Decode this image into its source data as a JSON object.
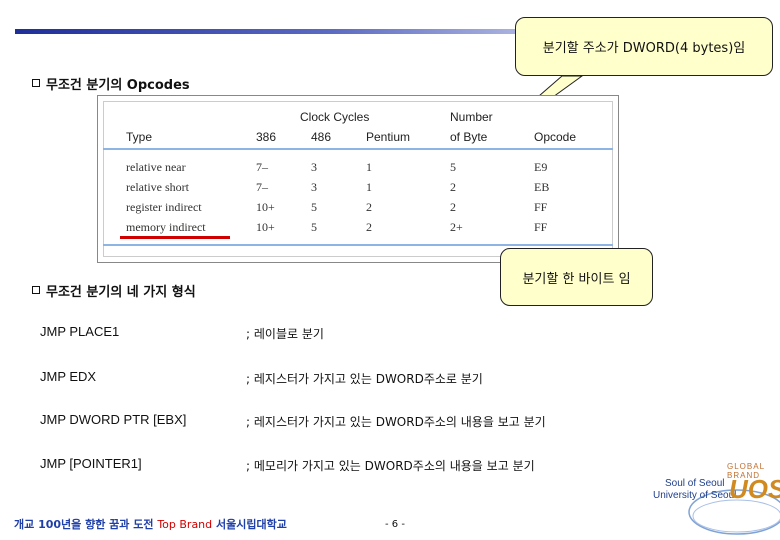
{
  "callouts": {
    "top": "분기할 주소가 DWORD(4 bytes)임",
    "bottom": "분기할 한 바이트 임"
  },
  "section1": {
    "title": "무조건 분기의 Opcodes"
  },
  "section2": {
    "title": "무조건 분기의 네 가지 형식"
  },
  "table": {
    "header_clock": "Clock Cycles",
    "header_number": "Number",
    "header_type": "Type",
    "header_386": "386",
    "header_486": "486",
    "header_pentium": "Pentium",
    "header_bytes": "of Byte",
    "header_opcode": "Opcode",
    "rows": [
      {
        "type": "relative near",
        "c386": "7–",
        "c486": "3",
        "pent": "1",
        "bytes": "5",
        "opcode": "E9"
      },
      {
        "type": "relative short",
        "c386": "7–",
        "c486": "3",
        "pent": "1",
        "bytes": "2",
        "opcode": "EB"
      },
      {
        "type": "register indirect",
        "c386": "10+",
        "c486": "5",
        "pent": "2",
        "bytes": "2",
        "opcode": "FF"
      },
      {
        "type": "memory indirect",
        "c386": "10+",
        "c486": "5",
        "pent": "2",
        "bytes": "2+",
        "opcode": "FF"
      }
    ]
  },
  "instructions": [
    {
      "code": "JMP PLACE1",
      "comment": "; 레이블로 분기"
    },
    {
      "code": "JMP EDX",
      "comment": "; 레지스터가  가지고 있는 DWORD주소로 분기"
    },
    {
      "code": "JMP DWORD PTR [EBX]",
      "comment": "; 레지스터가 가지고 있는 DWORD주소의 내용을 보고 분기"
    },
    {
      "code": "JMP [POINTER1]",
      "comment": "; 메모리가 가지고 있는 DWORD주소의 내용을 보고 분기"
    }
  ],
  "footer": {
    "prefix": "개교 100년을 향한 꿈과 도전 ",
    "brand": "Top Brand",
    "suffix": " 서울시립대학교",
    "page": "- 6 -"
  },
  "logo": {
    "line1": "GLOBAL BRAND",
    "line2": "Soul of Seoul",
    "line3": "University of Seoul",
    "mark": "UOS"
  },
  "colors": {
    "callout_bg": "#ffffcc",
    "table_rule": "#8eb4e3",
    "highlight": "#d00000",
    "footer_text": "#1f3fa8"
  }
}
